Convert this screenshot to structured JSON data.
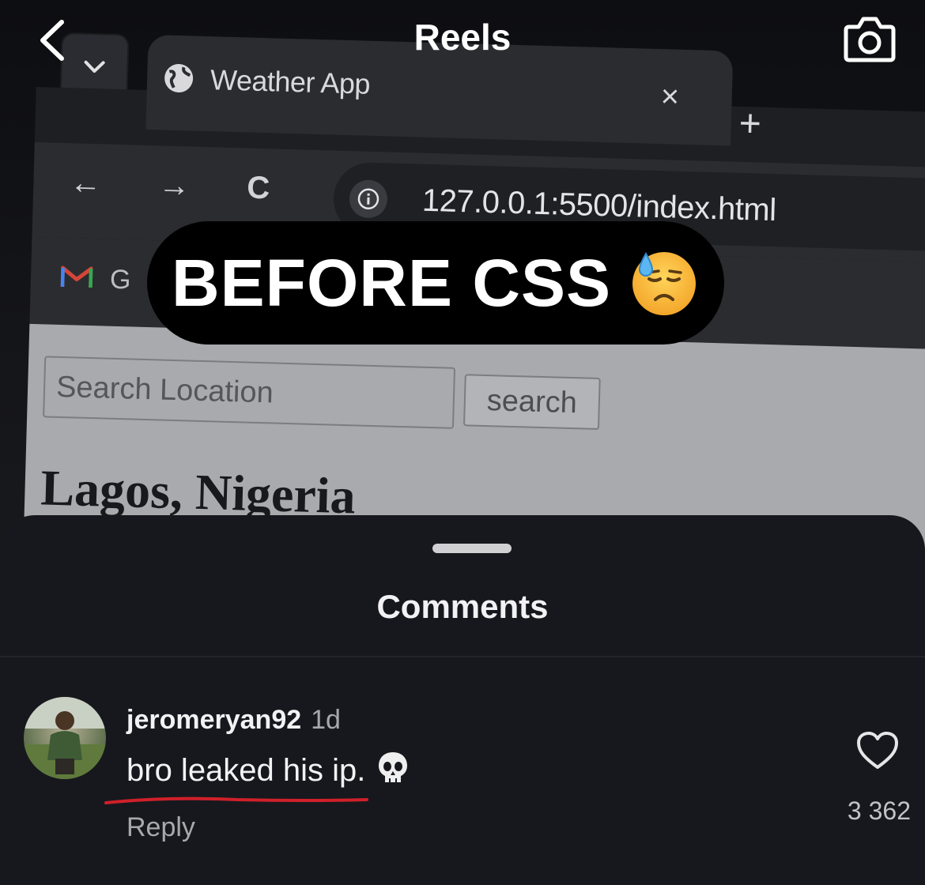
{
  "header": {
    "title": "Reels"
  },
  "browser": {
    "tab": {
      "title": "Weather App",
      "close_symbol": "×",
      "new_tab_symbol": "+"
    },
    "nav": {
      "back_symbol": "←",
      "forward_symbol": "→",
      "reload_symbol": "C"
    },
    "url": "127.0.0.1:5500/index.html",
    "bookmarks": {
      "first_label": "G"
    },
    "page": {
      "search_placeholder": "Search Location",
      "search_button": "search",
      "city": "Lagos, Nigeria"
    }
  },
  "caption": {
    "text": "BEFORE CSS",
    "emoji": "downcast-face-with-sweat"
  },
  "comments": {
    "title": "Comments",
    "items": [
      {
        "username": "jeromeryan92",
        "time": "1d",
        "text": "bro leaked his ip.",
        "emoji": "skull",
        "reply_label": "Reply",
        "likes": "3 362"
      }
    ]
  },
  "colors": {
    "sheet_bg": "#17181d",
    "underline": "#d0202a",
    "caption_bg": "#000000"
  }
}
